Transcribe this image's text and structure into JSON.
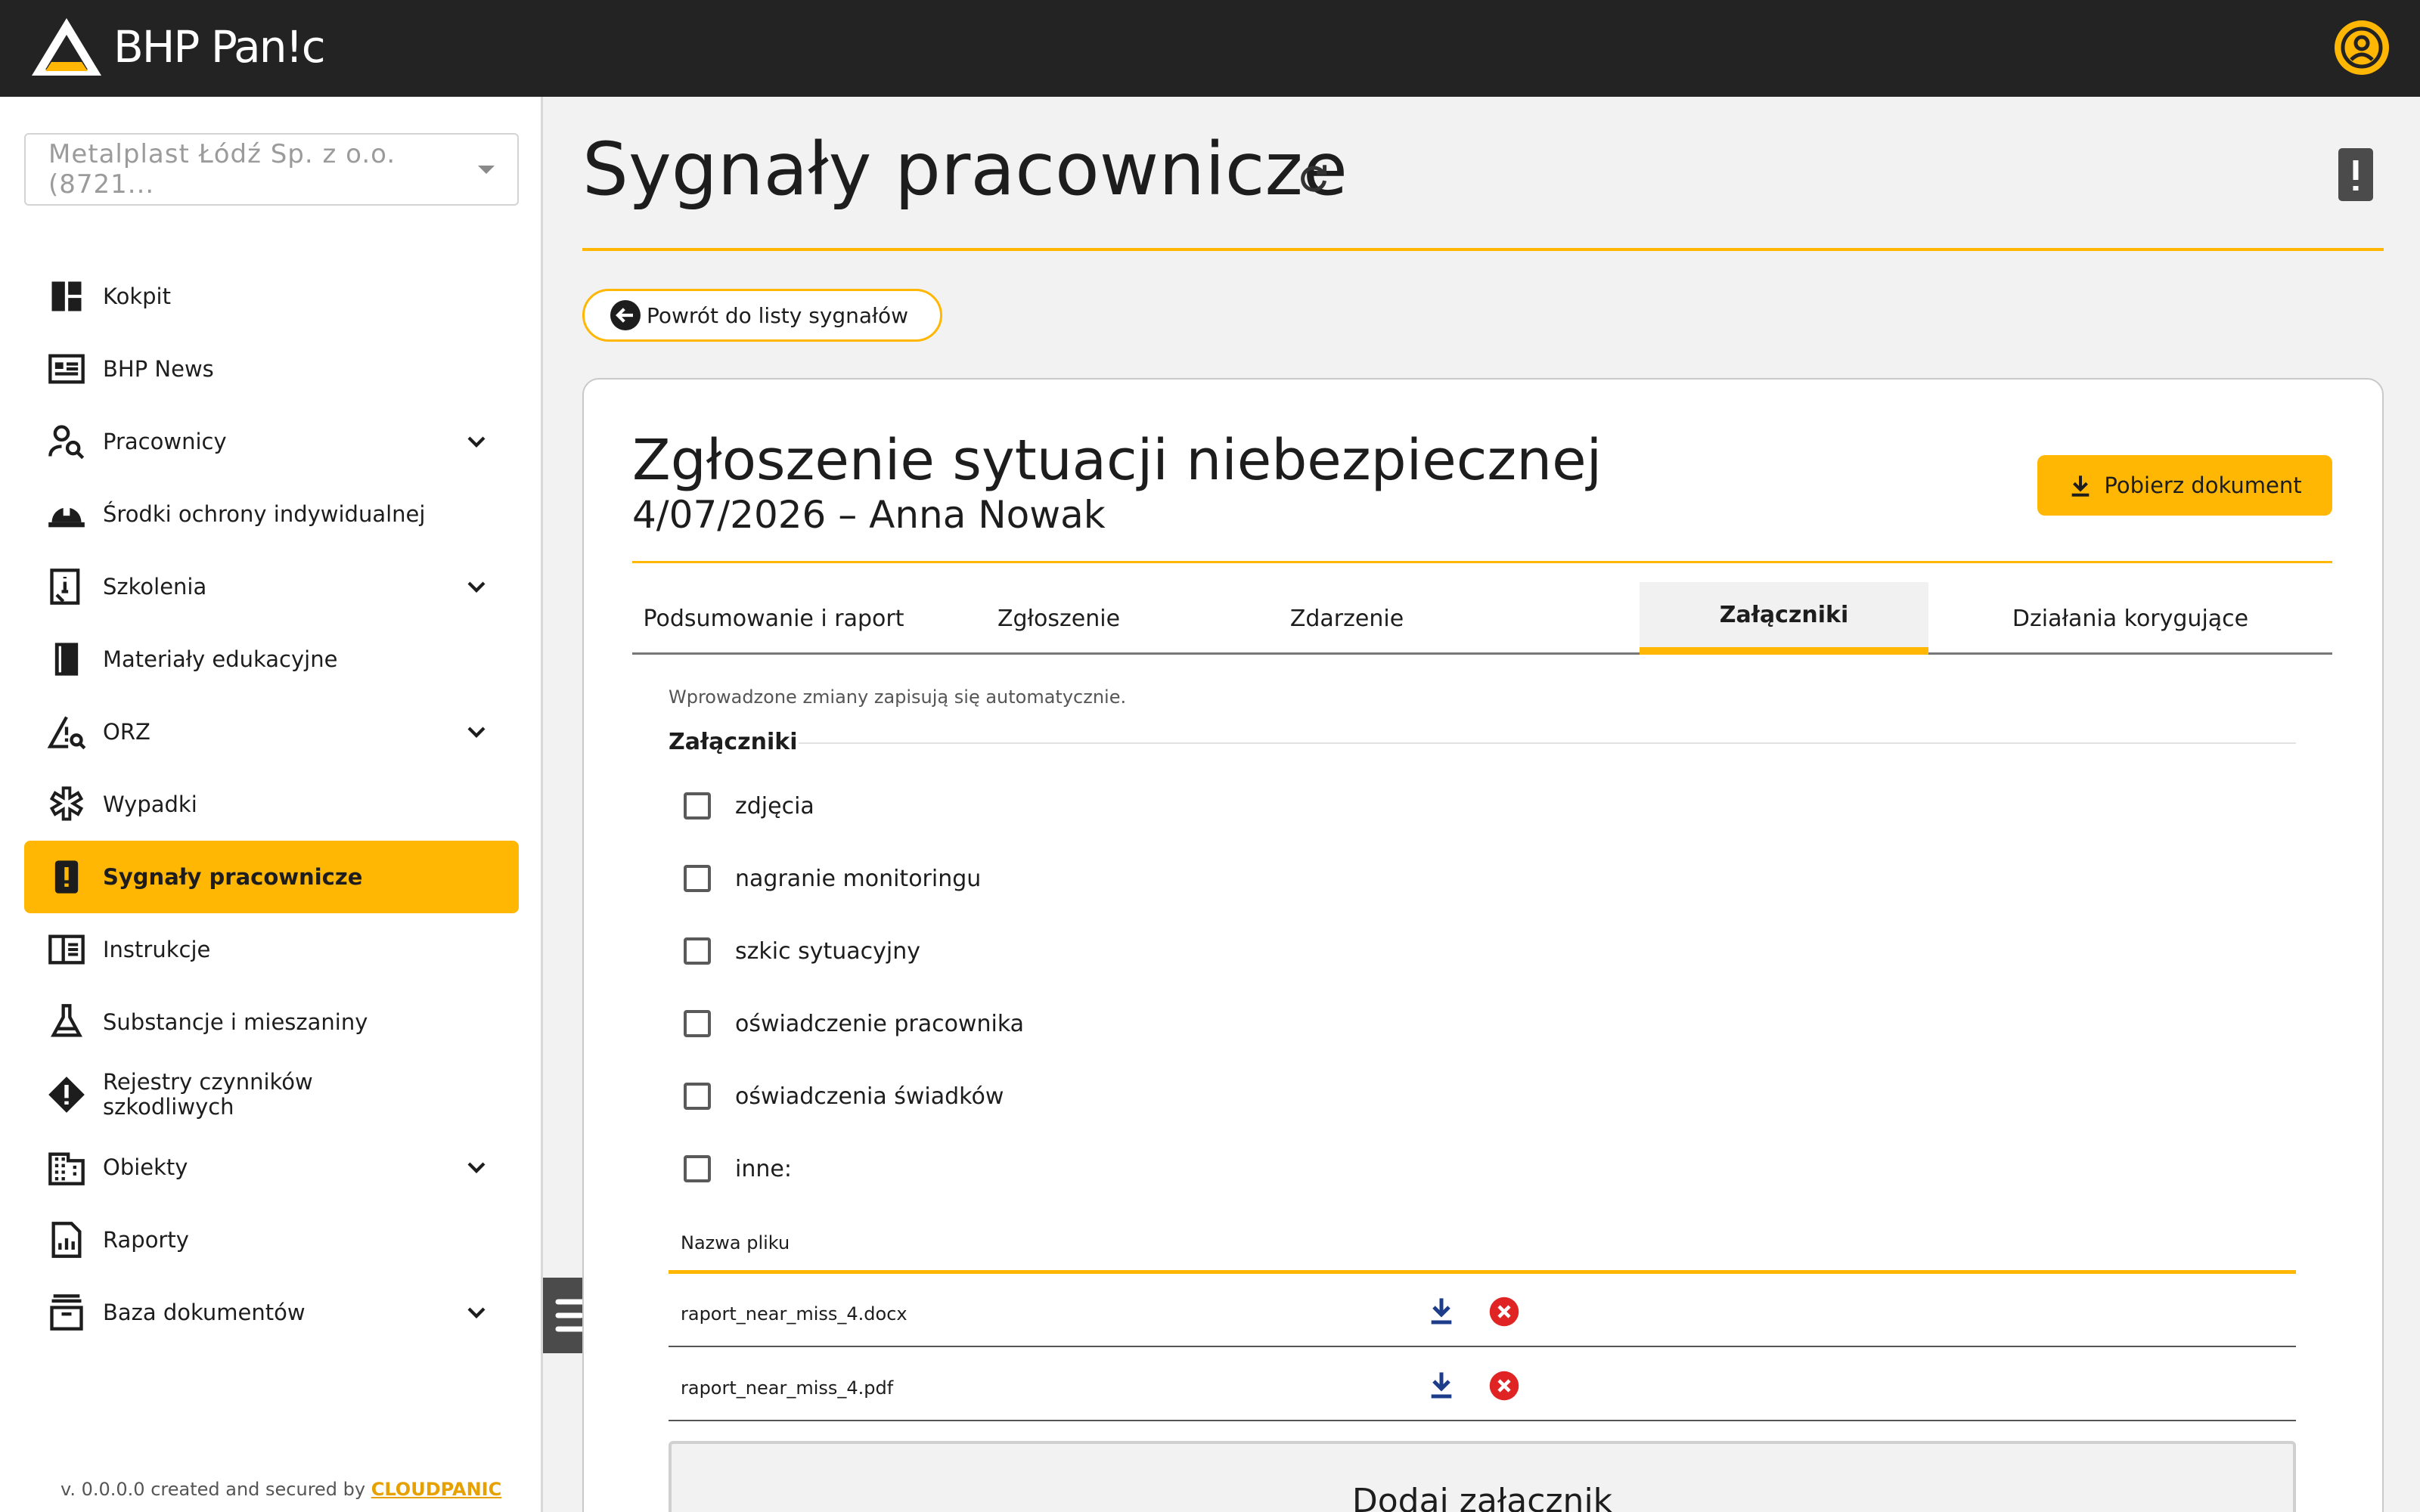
{
  "app": {
    "logo_text": "BHP Pan!c"
  },
  "sidebar": {
    "company": "Metalplast Łódź Sp. z o.o. (8721...",
    "items": [
      {
        "label": "Kokpit",
        "icon": "dashboard-icon"
      },
      {
        "label": "BHP News",
        "icon": "news-icon"
      },
      {
        "label": "Pracownicy",
        "icon": "person-search-icon",
        "expandable": true
      },
      {
        "label": "Środki ochrony indywidualnej",
        "icon": "helmet-icon"
      },
      {
        "label": "Szkolenia",
        "icon": "training-book-icon",
        "expandable": true
      },
      {
        "label": "Materiały edukacyjne",
        "icon": "book-icon"
      },
      {
        "label": "ORZ",
        "icon": "risk-assessment-icon",
        "expandable": true
      },
      {
        "label": "Wypadki",
        "icon": "medical-star-icon"
      },
      {
        "label": "Sygnały pracownicze",
        "icon": "report-alert-icon",
        "active": true
      },
      {
        "label": "Instrukcje",
        "icon": "instructions-icon"
      },
      {
        "label": "Substancje i mieszaniny",
        "icon": "flask-icon"
      },
      {
        "label": "Rejestry czynników szkodliwych",
        "icon": "warning-diamond-icon"
      },
      {
        "label": "Obiekty",
        "icon": "building-icon",
        "expandable": true
      },
      {
        "label": "Raporty",
        "icon": "report-chart-icon"
      },
      {
        "label": "Baza dokumentów",
        "icon": "archive-icon",
        "expandable": true
      }
    ],
    "footer_text": "v. 0.0.0.0 created and secured by",
    "footer_brand": "CLOUDPANIC"
  },
  "page": {
    "title": "Sygnały pracownicze",
    "back_label": "Powrót do listy sygnałów"
  },
  "form": {
    "title": "Zgłoszenie sytuacji niebezpiecznej",
    "subtitle": "4/07/2026 – Anna Nowak",
    "download_label": "Pobierz dokument",
    "tabs": [
      "Podsumowanie i raport",
      "Zgłoszenie",
      "Zdarzenie",
      "Załączniki",
      "Działania korygujące"
    ],
    "active_tab": "Załączniki",
    "autosave_note": "Wprowadzone zmiany zapisują się automatycznie.",
    "section_title": "Załączniki",
    "checkboxes": [
      {
        "label": "zdjęcia",
        "checked": false
      },
      {
        "label": "nagranie monitoringu",
        "checked": false
      },
      {
        "label": "szkic sytuacyjny",
        "checked": false
      },
      {
        "label": "oświadczenie pracownika",
        "checked": false
      },
      {
        "label": "oświadczenia świadków",
        "checked": false
      },
      {
        "label": "inne:",
        "checked": false
      }
    ],
    "files_header": "Nazwa pliku",
    "files": [
      "raport_near_miss_4.docx",
      "raport_near_miss_4.pdf"
    ],
    "add_label": "Dodaj załącznik"
  },
  "colors": {
    "accent": "#ffb703",
    "topbar": "#232323",
    "delete": "#e02424",
    "download": "#1d3d8a"
  }
}
